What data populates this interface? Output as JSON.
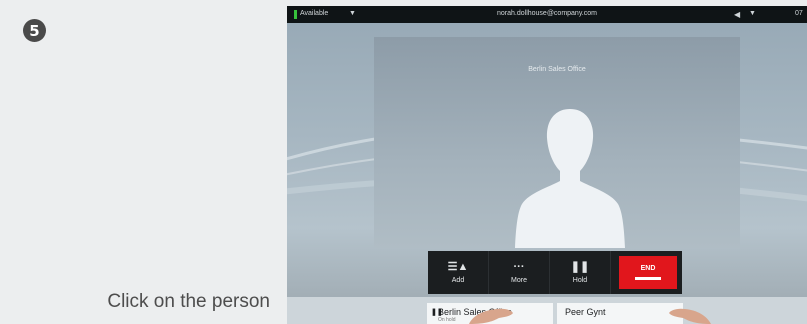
{
  "step": {
    "number": "5"
  },
  "instruction": {
    "text": "Click on the person"
  },
  "status_bar": {
    "availability": "Available",
    "email": "norah.dollhouse@company.com",
    "clock": "07"
  },
  "call": {
    "remote_name": "Berlin Sales Office"
  },
  "toolbar": {
    "add_label": "Add",
    "more_label": "More",
    "hold_label": "Hold",
    "end_label": "END"
  },
  "calls": [
    {
      "name": "Berlin Sales Office",
      "state": "On hold"
    },
    {
      "name": "Peer Gynt"
    }
  ],
  "colors": {
    "available": "#37c23c",
    "end_button": "#e1161c",
    "toolbar": "#1b1e20"
  },
  "icons": [
    "add-participant-icon",
    "more-icon",
    "hold-icon",
    "volume-icon",
    "pause-icon"
  ]
}
